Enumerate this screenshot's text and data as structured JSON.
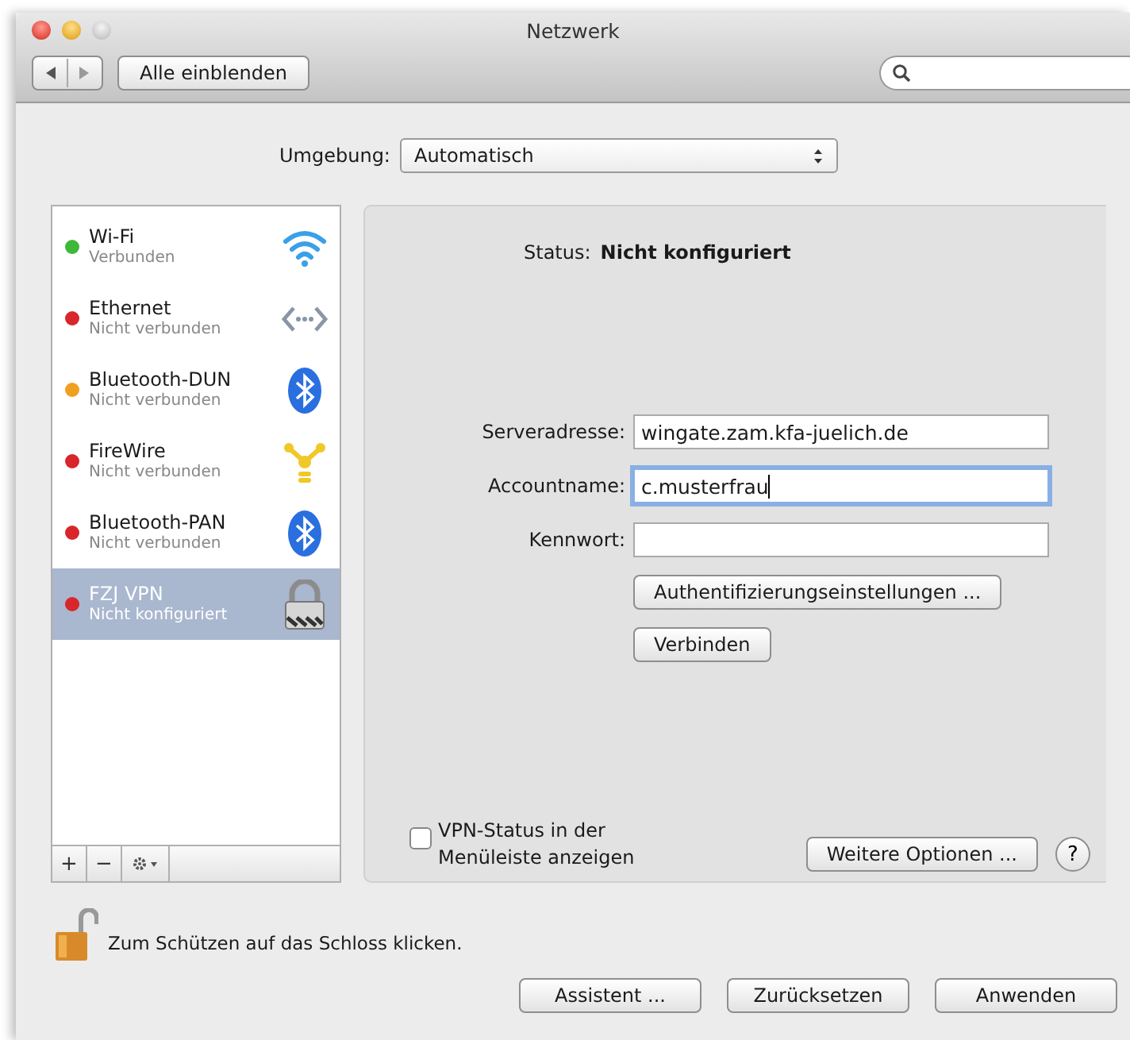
{
  "window": {
    "title": "Netzwerk"
  },
  "toolbar": {
    "show_all_button": "Alle einblenden"
  },
  "location": {
    "label": "Umgebung:",
    "value": "Automatisch"
  },
  "services": [
    {
      "name": "Wi-Fi",
      "status": "Verbunden",
      "color": "#3fb83a",
      "kind": "wifi",
      "selected": false
    },
    {
      "name": "Ethernet",
      "status": "Nicht verbunden",
      "color": "#d8262a",
      "kind": "ethernet",
      "selected": false
    },
    {
      "name": "Bluetooth-DUN",
      "status": "Nicht verbunden",
      "color": "#f0a020",
      "kind": "bluetooth",
      "selected": false
    },
    {
      "name": "FireWire",
      "status": "Nicht verbunden",
      "color": "#d8262a",
      "kind": "firewire",
      "selected": false
    },
    {
      "name": "Bluetooth-PAN",
      "status": "Nicht verbunden",
      "color": "#d8262a",
      "kind": "bluetooth",
      "selected": false
    },
    {
      "name": "FZJ VPN",
      "status": "Nicht konfiguriert",
      "color": "#d8262a",
      "kind": "vpn",
      "selected": true
    }
  ],
  "list_buttons": [
    "+",
    "−"
  ],
  "detail": {
    "status_label": "Status:",
    "status_value": "Nicht konfiguriert",
    "fields": [
      {
        "label": "Serveradresse:",
        "value": "wingate.zam.kfa-juelich.de",
        "focused": false
      },
      {
        "label": "Accountname:",
        "value": "c.musterfrau",
        "focused": true
      },
      {
        "label": "Kennwort:",
        "focused": false
      }
    ],
    "buttons": [
      "Authentifizierungseinstellungen ...",
      "Verbinden"
    ],
    "menu_status_checkbox": {
      "label": "VPN-Status in der Menüleiste anzeigen",
      "checked": false
    },
    "more_options_button": "Weitere Optionen ...",
    "help_button": "?"
  },
  "lock": {
    "text": "Zum Schützen auf das Schloss klicken."
  },
  "buttons": [
    "Assistent ...",
    "Zurücksetzen",
    "Anwenden"
  ]
}
